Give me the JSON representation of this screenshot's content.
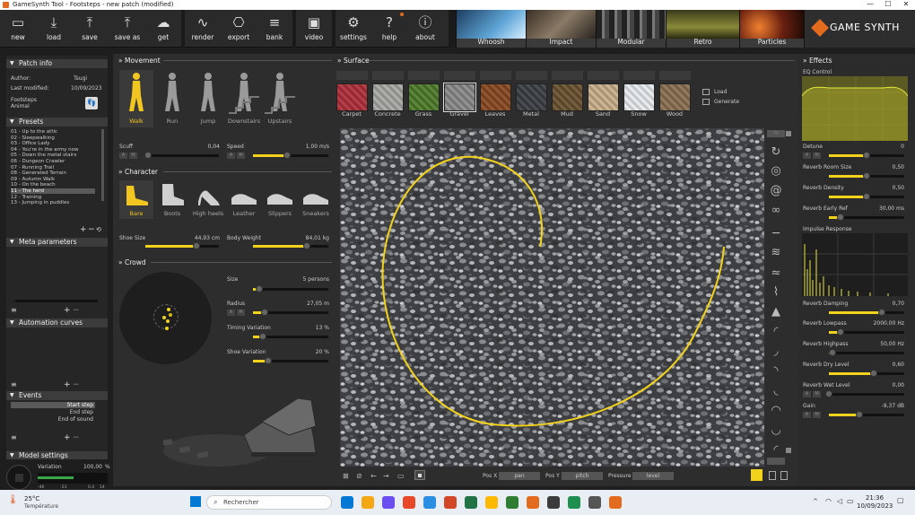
{
  "window": {
    "title": "GameSynth Tool - Footsteps - new patch (modified)",
    "min": "—",
    "max": "☐",
    "close": "✕"
  },
  "toolbar": {
    "buttons": [
      {
        "label": "new",
        "icon": "new-file-icon",
        "glyph": "▭"
      },
      {
        "label": "load",
        "icon": "load-icon",
        "glyph": "⤓"
      },
      {
        "label": "save",
        "icon": "save-icon",
        "glyph": "⤒"
      },
      {
        "label": "save as",
        "icon": "save-as-icon",
        "glyph": "⤒"
      },
      {
        "label": "get",
        "icon": "cloud-icon",
        "glyph": "☁"
      },
      {
        "label": "render",
        "icon": "render-icon",
        "glyph": "∿"
      },
      {
        "label": "export",
        "icon": "gamepad-icon",
        "glyph": "⎔"
      },
      {
        "label": "bank",
        "icon": "database-icon",
        "glyph": "≡"
      },
      {
        "label": "video",
        "icon": "video-icon",
        "glyph": "▣"
      },
      {
        "label": "settings",
        "icon": "gear-icon",
        "glyph": "⚙"
      },
      {
        "label": "help",
        "icon": "help-icon",
        "glyph": "?"
      },
      {
        "label": "about",
        "icon": "info-icon",
        "glyph": "ⓘ"
      }
    ],
    "presets": [
      {
        "label": "Whoosh",
        "color": "#2f6fa8"
      },
      {
        "label": "Impact",
        "color": "#5a4a3a"
      },
      {
        "label": "Modular",
        "color": "#555555"
      },
      {
        "label": "Retro",
        "color": "#6a6a3a"
      },
      {
        "label": "Particles",
        "color": "#8a3a1a"
      }
    ],
    "brand": "GAME SYNTH"
  },
  "patch_info": {
    "title": "Patch info",
    "author_label": "Author:",
    "author": "Tsugi",
    "modified_label": "Last modified:",
    "modified": "10/09/2023",
    "desc1": "Footsteps",
    "desc2": "Animal"
  },
  "presets": {
    "title": "Presets",
    "items": [
      "01 - Up to the attic",
      "02 - Sleepwalking",
      "03 - Office Lady",
      "04 - You're in the army now",
      "05 - Down the metal stairs",
      "06 - Dungeon Crawler",
      "07 - Running Trail",
      "08 - Generated Terrain",
      "09 - Autumn Walk",
      "10 - On the beach",
      "11 - The herd",
      "12 - Training",
      "13 - Jumping in puddles"
    ],
    "selected": 10
  },
  "meta": {
    "title": "Meta parameters"
  },
  "automation": {
    "title": "Automation curves"
  },
  "events": {
    "title": "Events",
    "items": [
      "Start step",
      "End step",
      "End of sound"
    ]
  },
  "model_settings": {
    "title": "Model settings"
  },
  "variation": {
    "label": "Variation",
    "value": "100,00",
    "unit": "%",
    "ticks": [
      "-46",
      "-23",
      "0.4",
      "14"
    ]
  },
  "movement": {
    "title": "Movement",
    "items": [
      "Walk",
      "Run",
      "Jump",
      "Downstairs",
      "Upstairs"
    ],
    "active": 0,
    "scuff": {
      "label": "Scuff",
      "value": "0,04",
      "level": 0.04
    },
    "speed": {
      "label": "Speed",
      "value": "1,00 m/s",
      "level": 0.45
    }
  },
  "character": {
    "title": "Character",
    "items": [
      "Bare",
      "Boots",
      "High heels",
      "Leather",
      "Slippers",
      "Sneakers"
    ],
    "active": 0,
    "shoe_size": {
      "label": "Shoe Size",
      "value": "44,93 cm",
      "level": 0.7
    },
    "body_weight": {
      "label": "Body Weight",
      "value": "84,01 kg",
      "level": 0.72
    }
  },
  "crowd": {
    "title": "Crowd",
    "size": {
      "label": "Size",
      "value": "5 persons",
      "level": 0.08
    },
    "radius": {
      "label": "Radius",
      "value": "27,05 m",
      "level": 0.16
    },
    "timing": {
      "label": "Timing Variation",
      "value": "13 %",
      "level": 0.13
    },
    "shoe_var": {
      "label": "Shoe Variation",
      "value": "20 %",
      "level": 0.2
    }
  },
  "surface": {
    "title": "Surface",
    "items": [
      {
        "label": "Carpet",
        "color": "#b0303a"
      },
      {
        "label": "Concrete",
        "color": "#a8a8a4"
      },
      {
        "label": "Grass",
        "color": "#4f7d2a"
      },
      {
        "label": "Gravel",
        "color": "#8a8a8a"
      },
      {
        "label": "Leaves",
        "color": "#8a4a22"
      },
      {
        "label": "Metal",
        "color": "#3c3f44"
      },
      {
        "label": "Mud",
        "color": "#6a5232"
      },
      {
        "label": "Sand",
        "color": "#c8b08a"
      },
      {
        "label": "Snow",
        "color": "#e8ecef"
      },
      {
        "label": "Wood",
        "color": "#8a7052"
      }
    ],
    "active": 3,
    "load": "Load",
    "generate": "Generate"
  },
  "bottom": {
    "posx_label": "Pos X",
    "posx": "pan",
    "posy_label": "Pos Y",
    "posy": "pitch",
    "pressure_label": "Pressure",
    "pressure": "level"
  },
  "effects": {
    "title": "Effects",
    "eq_label": "EQ Control",
    "detune": {
      "label": "Detune",
      "value": "0",
      "level": 0.5
    },
    "rev_room": {
      "label": "Reverb Room Size",
      "value": "0,50",
      "level": 0.5
    },
    "rev_density": {
      "label": "Reverb Density",
      "value": "0,50",
      "level": 0.5
    },
    "rev_early": {
      "label": "Reverb Early Ref",
      "value": "30,00 ms",
      "level": 0.15
    },
    "impulse_label": "Impulse Response",
    "rev_damping": {
      "label": "Reverb Damping",
      "value": "0,70",
      "level": 0.7
    },
    "rev_lowpass": {
      "label": "Reverb Lowpass",
      "value": "2000,00 Hz",
      "level": 0.15
    },
    "rev_highpass": {
      "label": "Reverb Highpass",
      "value": "50,00 Hz",
      "level": 0.05
    },
    "rev_dry": {
      "label": "Reverb Dry Level",
      "value": "0,60",
      "level": 0.6
    },
    "rev_wet": {
      "label": "Reverb Wet Level",
      "value": "0,00",
      "level": 0.0
    },
    "gain": {
      "label": "Gain",
      "value": "-9,37 dB",
      "level": 0.4
    }
  },
  "taskbar": {
    "temp": "25°C",
    "weather": "Température",
    "search": "Rechercher",
    "time": "21:36",
    "date": "10/09/2023",
    "app_colors": [
      "#0078d4",
      "#f3a712",
      "#6b4df0",
      "#e8482a",
      "#2a8fe3",
      "#d24726",
      "#217346",
      "#ffb900",
      "#2e7d32",
      "#e36b1f",
      "#3b3b3b",
      "#1e8f4f",
      "#555555",
      "#e36b1f"
    ]
  }
}
